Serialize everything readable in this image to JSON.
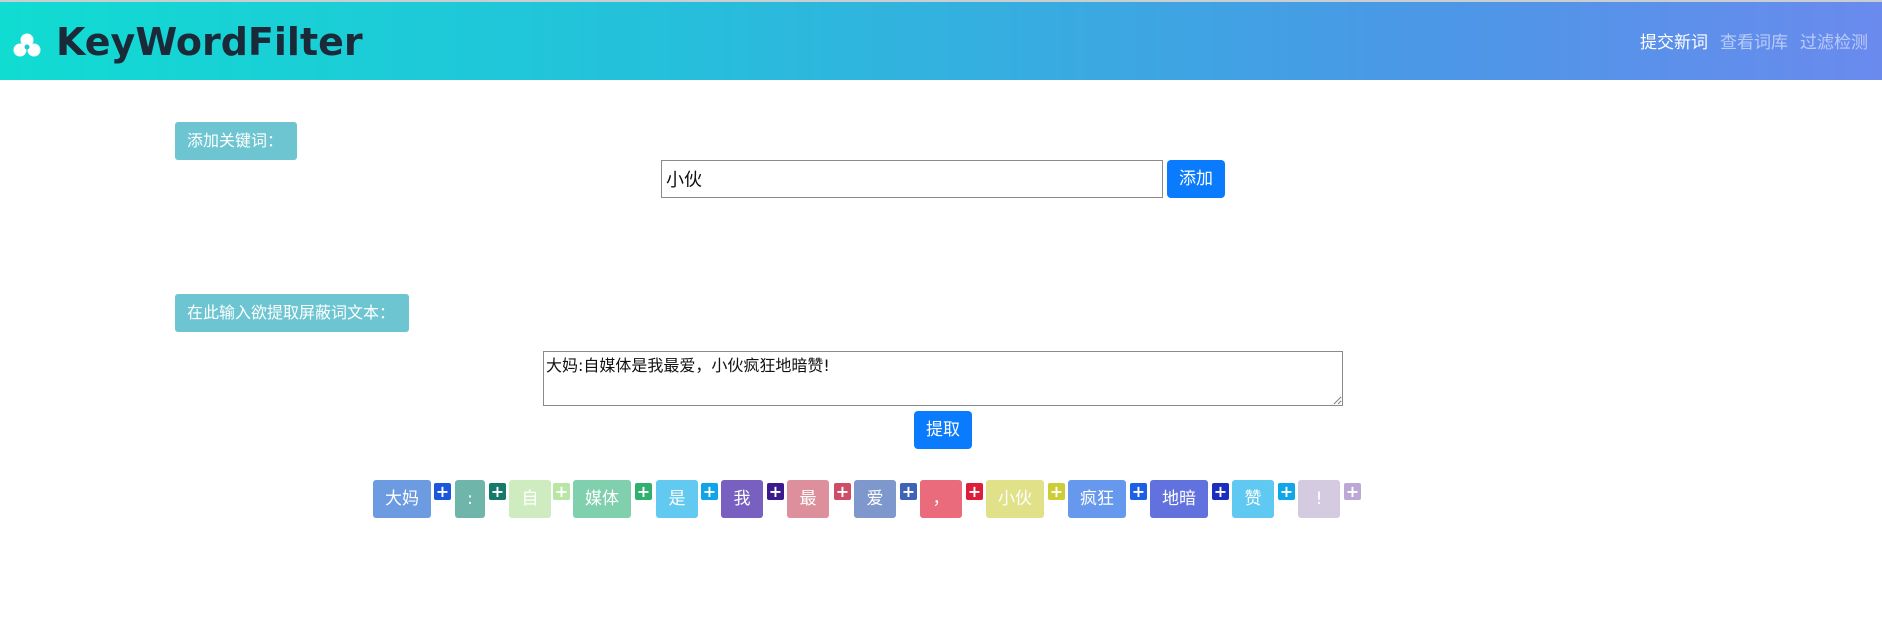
{
  "app": {
    "brand": "KeyWordFilter"
  },
  "nav": {
    "items": [
      {
        "label": "提交新词",
        "active": true
      },
      {
        "label": "查看词库",
        "active": false
      },
      {
        "label": "过滤检测",
        "active": false
      }
    ]
  },
  "add_section": {
    "label": "添加关键词：",
    "input_value": "小伙",
    "button_label": "添加"
  },
  "extract_section": {
    "label": "在此输入欲提取屏蔽词文本：",
    "text_value": "大妈:自媒体是我最爱，小伙疯狂地暗赞!",
    "button_label": "提取"
  },
  "tokens": [
    {
      "text": "大妈",
      "color": "#6d9be2",
      "plus_color": "#1a57dc"
    },
    {
      "text": ":",
      "color": "#6fb5aa",
      "plus_color": "#167a6a"
    },
    {
      "text": "自",
      "color": "#cfecc1",
      "plus_color": "#b9e6a5"
    },
    {
      "text": "媒体",
      "color": "#80d0ae",
      "plus_color": "#2fb06e"
    },
    {
      "text": "是",
      "color": "#62caf0",
      "plus_color": "#10a4e8"
    },
    {
      "text": "我",
      "color": "#7760c0",
      "plus_color": "#3a1a8c"
    },
    {
      "text": "最",
      "color": "#dd909c",
      "plus_color": "#cd4e66"
    },
    {
      "text": "爱",
      "color": "#7e97cc",
      "plus_color": "#3e62b6"
    },
    {
      "text": "，",
      "color": "#ea6b7c",
      "plus_color": "#dc1e3a"
    },
    {
      "text": "小伙",
      "color": "#e1e189",
      "plus_color": "#cdcd38"
    },
    {
      "text": "疯狂",
      "color": "#6699ee",
      "plus_color": "#1c60e6"
    },
    {
      "text": "地暗",
      "color": "#6171de",
      "plus_color": "#1c2ec0"
    },
    {
      "text": "赞",
      "color": "#5fc9f1",
      "plus_color": "#0fa7e8"
    },
    {
      "text": "!",
      "color": "#d4cbe1",
      "plus_color": "#bda8d5"
    }
  ],
  "icons": {
    "brand": "trefoil-clover-icon",
    "plus": "plus-icon"
  },
  "colors": {
    "primary": "#0a7bfc",
    "label_bg": "#6ec5d2",
    "nav_gradient_start": "#10dcd2",
    "nav_gradient_end": "#6a8aee"
  }
}
